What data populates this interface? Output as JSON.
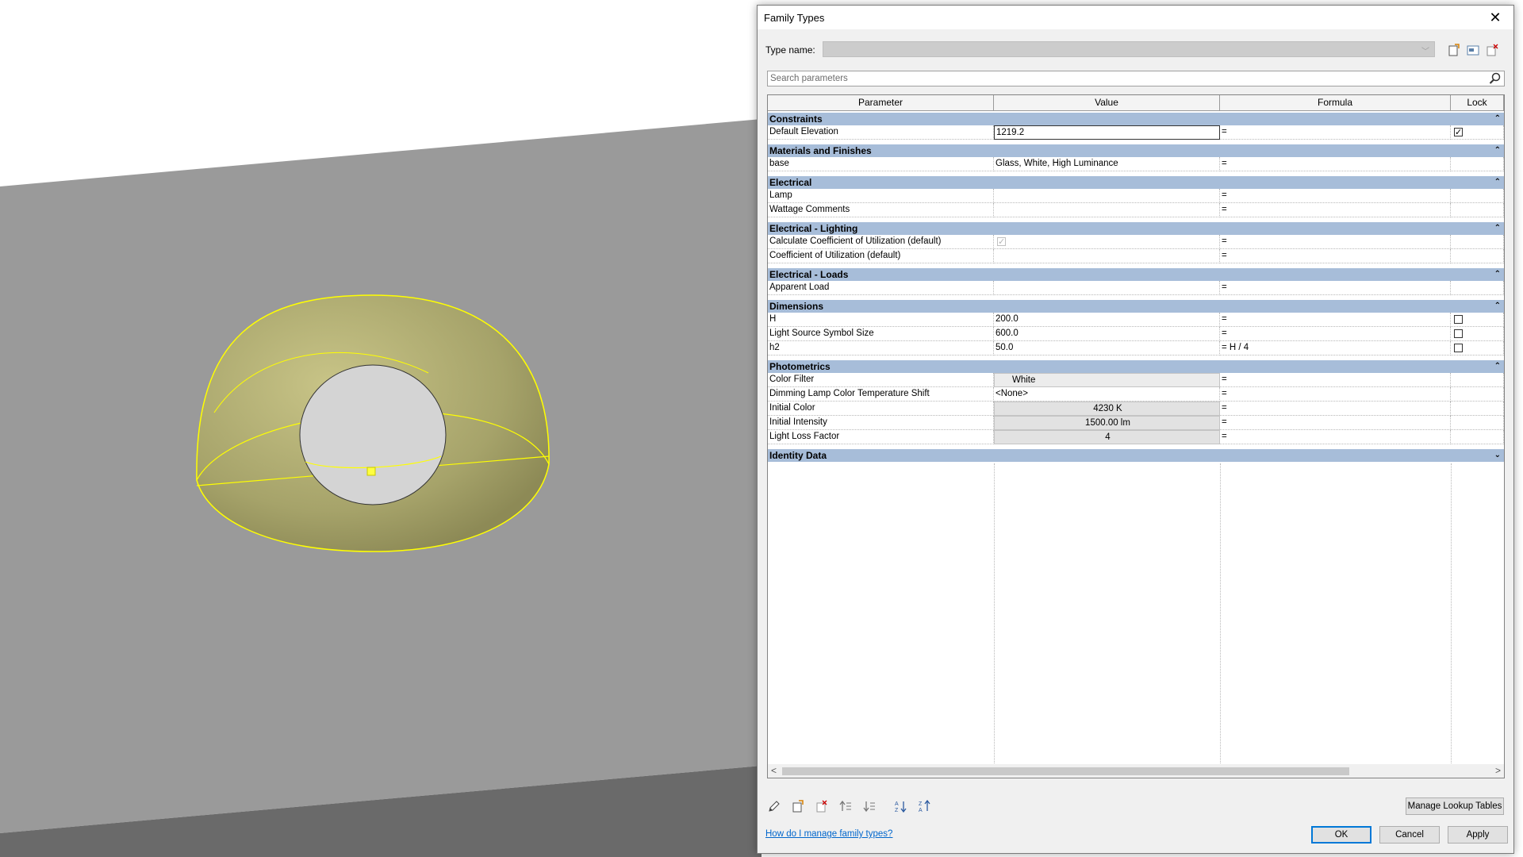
{
  "dialog": {
    "title": "Family Types",
    "close_glyph": "✕",
    "type_name_label": "Type name:",
    "type_name_value": "",
    "search_placeholder": "Search parameters"
  },
  "columns": [
    "Parameter",
    "Value",
    "Formula",
    "Lock"
  ],
  "groups": {
    "constraints": "Constraints",
    "materials": "Materials and Finishes",
    "electrical": "Electrical",
    "lighting": "Electrical - Lighting",
    "loads": "Electrical - Loads",
    "dimensions": "Dimensions",
    "photometrics": "Photometrics",
    "identity": "Identity Data"
  },
  "rows": {
    "default_elevation": {
      "name": "Default Elevation",
      "value": "1219.2",
      "formula": "=",
      "locked": true
    },
    "base": {
      "name": "base",
      "value": "Glass, White, High Luminance",
      "formula": "="
    },
    "lamp": {
      "name": "Lamp",
      "value": "",
      "formula": "="
    },
    "wattage": {
      "name": "Wattage Comments",
      "value": "",
      "formula": "="
    },
    "calc_cu": {
      "name": "Calculate Coefficient of Utilization (default)",
      "value_checked": true,
      "formula": "="
    },
    "cu": {
      "name": "Coefficient of Utilization (default)",
      "value": "",
      "formula": "="
    },
    "apparent_load": {
      "name": "Apparent Load",
      "value": "",
      "formula": "="
    },
    "h": {
      "name": "H",
      "value": "200.0",
      "formula": "=",
      "locked": false
    },
    "symbol_size": {
      "name": "Light Source Symbol Size",
      "value": "600.0",
      "formula": "=",
      "locked": false
    },
    "h2": {
      "name": "h2",
      "value": "50.0",
      "formula": "= H / 4",
      "locked": false
    },
    "color_filter": {
      "name": "Color Filter",
      "value": "White",
      "formula": "="
    },
    "dimming": {
      "name": "Dimming Lamp Color Temperature Shift",
      "value": "<None>",
      "formula": "="
    },
    "initial_color": {
      "name": "Initial Color",
      "value": "4230 K",
      "formula": "="
    },
    "initial_intensity": {
      "name": "Initial Intensity",
      "value": "1500.00 lm",
      "formula": "="
    },
    "llf": {
      "name": "Light Loss Factor",
      "value": "4",
      "formula": "="
    }
  },
  "footer": {
    "manage_lookup": "Manage Lookup Tables",
    "help_link": "How do I manage family types?",
    "ok": "OK",
    "cancel": "Cancel",
    "apply": "Apply"
  },
  "icons": {
    "collapse": "⌃",
    "expand": "⌄",
    "scroll_left": "<",
    "scroll_right": ">"
  },
  "colors": {
    "group_header": "#a7bdd9",
    "selection": "#ffff00",
    "viewport_wall": "#9a9a9a"
  }
}
